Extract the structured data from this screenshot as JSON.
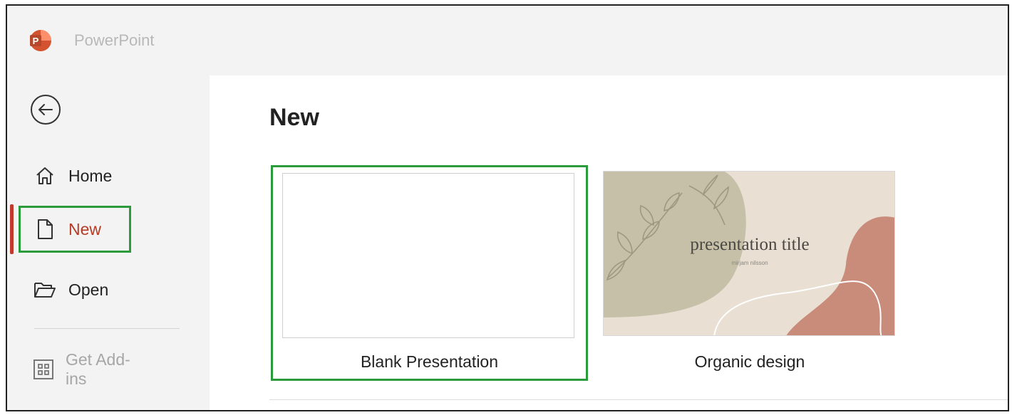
{
  "app": {
    "title": "PowerPoint",
    "logo_letter": "P",
    "accent": "#c43e1c"
  },
  "sidebar": {
    "items": [
      {
        "label": "Home",
        "icon": "home-icon",
        "active": false
      },
      {
        "label": "New",
        "icon": "new-document-icon",
        "active": true
      },
      {
        "label": "Open",
        "icon": "open-folder-icon",
        "active": false
      },
      {
        "label": "Get Add-ins",
        "icon": "add-ins-grid-icon",
        "active": false,
        "disabled": true
      }
    ],
    "active_color": "#b63b26"
  },
  "main": {
    "title": "New",
    "templates": [
      {
        "label": "Blank Presentation",
        "selected": true
      },
      {
        "label": "Organic design",
        "thumb_title": "presentation title",
        "thumb_subtitle": "mirjam nilsson",
        "selected": false
      }
    ]
  },
  "highlight_color": "#2a9a3a"
}
